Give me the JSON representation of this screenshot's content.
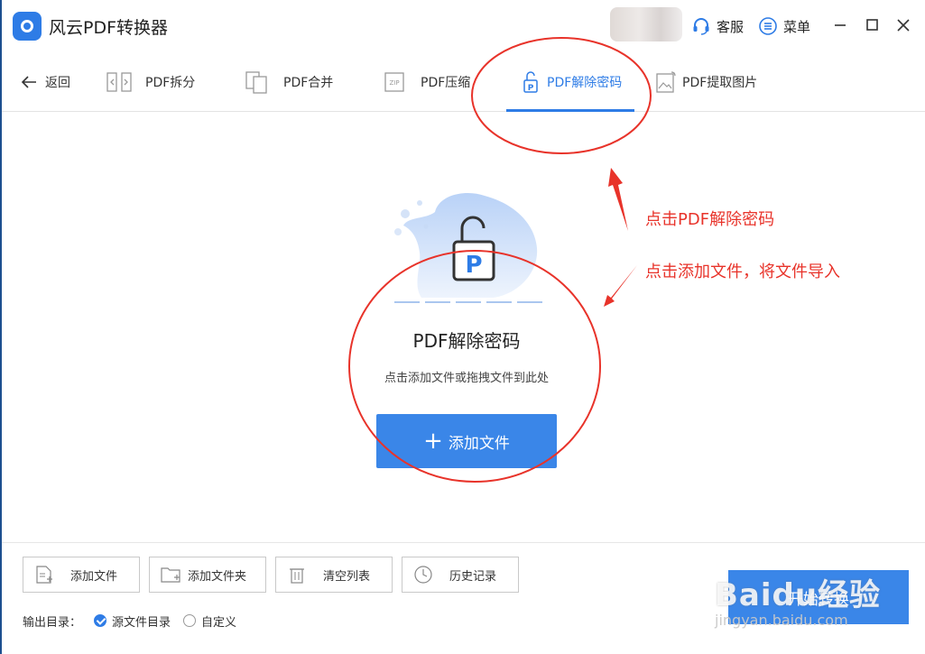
{
  "app": {
    "title": "风云PDF转换器"
  },
  "titlebar": {
    "service_label": "客服",
    "menu_label": "菜单"
  },
  "tabs": [
    {
      "label": "返回"
    },
    {
      "label": "PDF拆分"
    },
    {
      "label": "PDF合并"
    },
    {
      "label": "PDF压缩"
    },
    {
      "label": "PDF解除密码",
      "active": true
    },
    {
      "label": "PDF提取图片"
    }
  ],
  "main": {
    "title": "PDF解除密码",
    "hint": "点击添加文件或拖拽文件到此处",
    "add_button": "添加文件"
  },
  "bottom": {
    "buttons": [
      {
        "label": "添加文件"
      },
      {
        "label": "添加文件夹"
      },
      {
        "label": "清空列表"
      },
      {
        "label": "历史记录"
      }
    ],
    "output_label": "输出目录：",
    "options": [
      {
        "label": "源文件目录",
        "selected": true
      },
      {
        "label": "自定义",
        "selected": false
      }
    ],
    "start_button": "开始转换"
  },
  "annotations": {
    "note1": "点击PDF解除密码",
    "note2": "点击添加文件，将文件导入"
  },
  "watermark": {
    "main": "Baidu经验",
    "sub": "jingyan.baidu.com"
  },
  "colors": {
    "accent": "#2e7ce6",
    "button": "#3a86e8",
    "annotation": "#e8332a"
  }
}
